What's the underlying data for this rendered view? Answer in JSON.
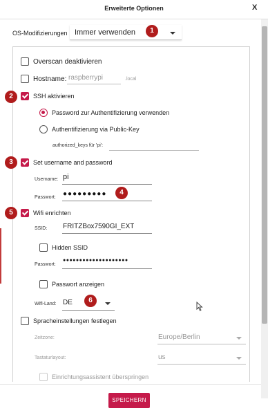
{
  "dialog": {
    "title": "Erweiterte Optionen",
    "close_label": "X"
  },
  "os_mod": {
    "label": "OS-Modifizierungen",
    "value": "Immer verwenden"
  },
  "overscan": {
    "label": "Overscan deaktivieren",
    "checked": false
  },
  "hostname": {
    "label": "Hostname:",
    "value": "raspberrypi",
    "suffix": ".local",
    "checked": false
  },
  "ssh": {
    "label": "SSH aktivieren",
    "checked": true,
    "radio_password": "Password zur Authentifizierung verwenden",
    "radio_pubkey": "Authentifizierung via Public-Key",
    "authorized_keys_label": "authorized_keys für 'pi':"
  },
  "user": {
    "label": "Set username and password",
    "checked": true,
    "username_label": "Username:",
    "username": "pi",
    "password_label": "Passwort:",
    "password": "●●●●●●●●●"
  },
  "wifi": {
    "label": "Wifi enrichten",
    "checked": true,
    "ssid_label": "SSID:",
    "ssid": "FRITZBox7590GI_EXT",
    "hidden_ssid_label": "Hidden SSID",
    "password_label": "Passwort:",
    "password": "●●●●●●●●●●●●●●●●●●●●",
    "show_password_label": "Passwort anzeigen",
    "country_label": "Wifi-Land:",
    "country": "DE"
  },
  "locale": {
    "label": "Spracheinstellungen festlegen",
    "checked": false,
    "timezone_label": "Zeitzone:",
    "timezone": "Europe/Berlin",
    "keyboard_label": "Tastaturlayout:",
    "keyboard": "us",
    "wizard_label": "Einrichtungsassistent überspringen"
  },
  "save_label": "SPEICHERN",
  "badges": [
    "1",
    "2",
    "3",
    "4",
    "5",
    "6"
  ],
  "colors": {
    "accent": "#c51a4a",
    "badge": "#b01c1c"
  }
}
